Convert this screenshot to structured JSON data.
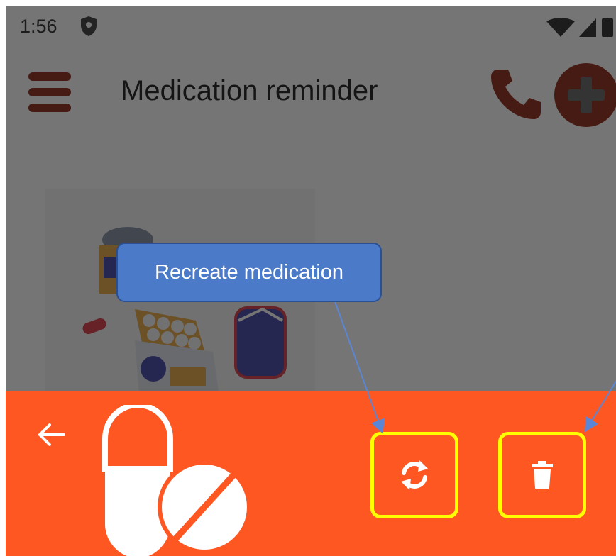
{
  "status_bar": {
    "time": "1:56"
  },
  "app_bar": {
    "title": "Medication reminder"
  },
  "tutorial": {
    "callout_text": "Recreate medication"
  },
  "colors": {
    "accent_orange": "#ff5722",
    "brand_dark_red": "#8b1e0a",
    "highlight_yellow": "#ffff00",
    "callout_blue": "#4a7ac8"
  },
  "icons": {
    "menu": "hamburger-menu-icon",
    "call": "phone-icon",
    "add": "add-circle-icon",
    "back": "arrow-left-icon",
    "medication": "pills-icon",
    "recreate": "refresh-icon",
    "delete": "trash-icon"
  }
}
